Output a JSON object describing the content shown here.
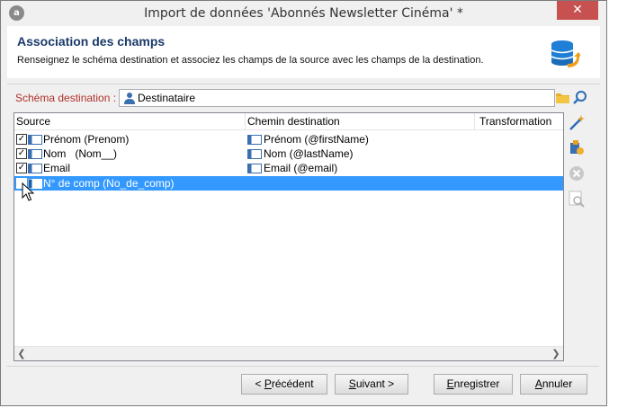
{
  "window": {
    "title": "Import de données 'Abonnés Newsletter Cinéma' *",
    "close_glyph": "✕"
  },
  "header": {
    "title": "Association des champs",
    "description": "Renseignez le schéma destination et associez les champs de la source avec les champs de la destination."
  },
  "schema": {
    "label": "Schéma destination :",
    "value": "Destinataire"
  },
  "table": {
    "columns": [
      "Source",
      "Chemin destination",
      "Transformation"
    ],
    "rows": [
      {
        "checked": true,
        "source": "Prénom (Prenom)",
        "destination": "Prénom (@firstName)",
        "selected": false
      },
      {
        "checked": true,
        "source": "Nom   (Nom__)",
        "destination": "Nom (@lastName)",
        "selected": false
      },
      {
        "checked": true,
        "source": "Email",
        "destination": "Email (@email)",
        "selected": false
      },
      {
        "checked": false,
        "source": "N° de comp (No_de_comp)",
        "destination": "",
        "selected": true
      }
    ]
  },
  "buttons": {
    "previous": {
      "mnemonic": "P",
      "rest_before": "< ",
      "rest_after": "récédent"
    },
    "next": {
      "mnemonic": "S",
      "rest_after": "uivant >"
    },
    "save": {
      "mnemonic": "E",
      "rest_after": "nregistrer"
    },
    "cancel": {
      "mnemonic": "A",
      "rest_after": "nnuler"
    }
  },
  "colors": {
    "selection": "#3399ff",
    "close": "#c75050",
    "schema_label": "#b0302a",
    "header_title": "#1a3a6a"
  },
  "icons": [
    "app-icon",
    "close-icon",
    "database-import-icon",
    "user-icon",
    "folder-icon",
    "search-icon",
    "field-icon",
    "magic-wand-icon",
    "add-expression-icon",
    "delete-icon",
    "preview-icon",
    "checkbox-icon",
    "cursor-icon",
    "arrow-left-icon",
    "arrow-right-icon"
  ]
}
